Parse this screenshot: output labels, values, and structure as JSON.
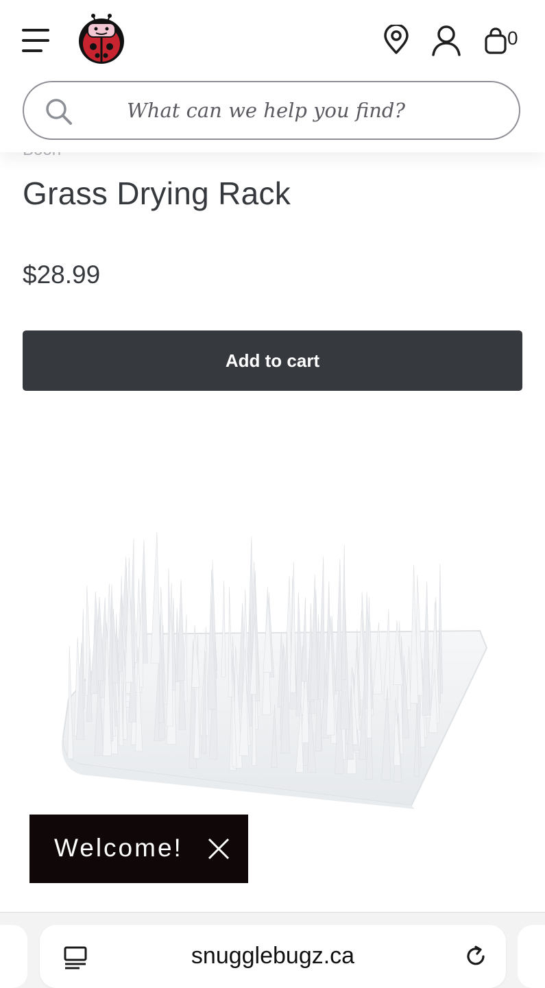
{
  "header": {
    "cart_count": "0",
    "icons": [
      "menu-icon",
      "store-locator-icon",
      "account-icon",
      "cart-icon",
      "search-icon"
    ]
  },
  "search": {
    "placeholder": "What can we help you find?"
  },
  "product": {
    "brand": "Boon",
    "title": "Grass Drying Rack",
    "price": "$28.99",
    "add_to_cart_label": "Add to cart",
    "image_description": "white grass-style bottle drying rack"
  },
  "welcome_toast": {
    "text": "Welcome!"
  },
  "browser": {
    "url": "snugglebugz.ca"
  },
  "colors": {
    "text": "#35383c",
    "button_bg": "#36393d",
    "toast_bg": "#0f0708",
    "ladybug_red": "#c8242f"
  }
}
